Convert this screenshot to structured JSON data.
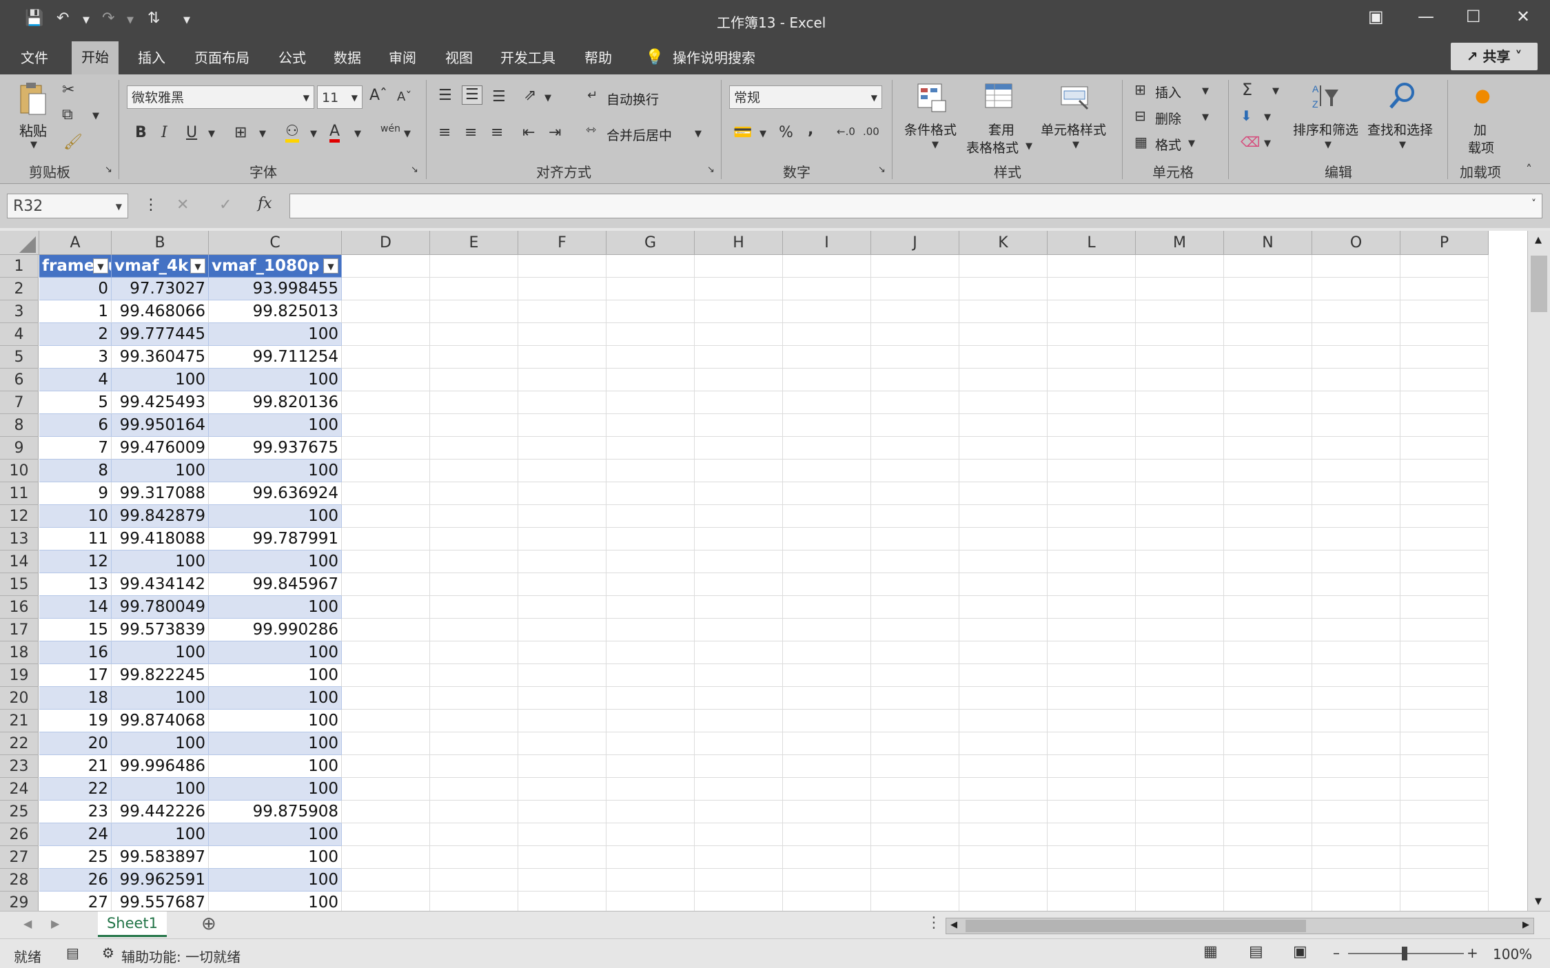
{
  "titlebar": {
    "title": "工作簿13  -  Excel",
    "quick_access": {
      "save_icon": "save-icon",
      "undo_icon": "undo-icon",
      "redo_icon": "redo-icon",
      "sort_icon": "sort-icon",
      "customize_icon": "customize-icon"
    },
    "window_controls": [
      "ribbon-display-icon",
      "minimize-icon",
      "maximize-icon",
      "close-icon"
    ]
  },
  "menu": {
    "tabs": [
      "文件",
      "开始",
      "插入",
      "页面布局",
      "公式",
      "数据",
      "审阅",
      "视图",
      "开发工具",
      "帮助"
    ],
    "active_tab": "开始",
    "tell_me": "操作说明搜索",
    "share": "共享"
  },
  "ribbon": {
    "clipboard": {
      "label": "剪贴板",
      "paste": "粘贴"
    },
    "font": {
      "label": "字体",
      "font_name": "微软雅黑",
      "font_size": "11",
      "bold": "B",
      "italic": "I",
      "underline": "U",
      "wen": "wén"
    },
    "alignment": {
      "label": "对齐方式",
      "wrap_text": "自动换行",
      "merge_center": "合并后居中"
    },
    "number": {
      "label": "数字",
      "format": "常规",
      "percent": "%",
      "comma": ","
    },
    "styles": {
      "label": "样式",
      "conditional": "条件格式",
      "table_format_1": "套用",
      "table_format_2": "表格格式",
      "cell_styles": "单元格样式"
    },
    "cells": {
      "label": "单元格",
      "insert": "插入",
      "delete": "删除",
      "format": "格式"
    },
    "editing": {
      "label": "编辑",
      "sum": "Σ",
      "sort_filter": "排序和筛选",
      "find_select": "查找和选择"
    },
    "addins": {
      "label": "加载项",
      "addins_1": "加",
      "addins_2": "载项"
    }
  },
  "formula_bar": {
    "name_box": "R32",
    "fx": "fx",
    "formula": ""
  },
  "sheet": {
    "columns": [
      "A",
      "B",
      "C",
      "D",
      "E",
      "F",
      "G",
      "H",
      "I",
      "J",
      "K",
      "L",
      "M",
      "N",
      "O",
      "P"
    ],
    "row_numbers": [
      "1",
      "2",
      "3",
      "4",
      "5",
      "6",
      "7",
      "8",
      "9",
      "10",
      "11",
      "12",
      "13",
      "14",
      "15",
      "16",
      "17",
      "18",
      "19",
      "20",
      "21",
      "22",
      "23",
      "24",
      "25",
      "26",
      "27",
      "28",
      "29"
    ],
    "table_headers": [
      "frameNum",
      "vmaf_4k",
      "vmaf_1080p"
    ],
    "rows": [
      [
        "0",
        "97.73027",
        "93.998455"
      ],
      [
        "1",
        "99.468066",
        "99.825013"
      ],
      [
        "2",
        "99.777445",
        "100"
      ],
      [
        "3",
        "99.360475",
        "99.711254"
      ],
      [
        "4",
        "100",
        "100"
      ],
      [
        "5",
        "99.425493",
        "99.820136"
      ],
      [
        "6",
        "99.950164",
        "100"
      ],
      [
        "7",
        "99.476009",
        "99.937675"
      ],
      [
        "8",
        "100",
        "100"
      ],
      [
        "9",
        "99.317088",
        "99.636924"
      ],
      [
        "10",
        "99.842879",
        "100"
      ],
      [
        "11",
        "99.418088",
        "99.787991"
      ],
      [
        "12",
        "100",
        "100"
      ],
      [
        "13",
        "99.434142",
        "99.845967"
      ],
      [
        "14",
        "99.780049",
        "100"
      ],
      [
        "15",
        "99.573839",
        "99.990286"
      ],
      [
        "16",
        "100",
        "100"
      ],
      [
        "17",
        "99.822245",
        "100"
      ],
      [
        "18",
        "100",
        "100"
      ],
      [
        "19",
        "99.874068",
        "100"
      ],
      [
        "20",
        "100",
        "100"
      ],
      [
        "21",
        "99.996486",
        "100"
      ],
      [
        "22",
        "100",
        "100"
      ],
      [
        "23",
        "99.442226",
        "99.875908"
      ],
      [
        "24",
        "100",
        "100"
      ],
      [
        "25",
        "99.583897",
        "100"
      ],
      [
        "26",
        "99.962591",
        "100"
      ],
      [
        "27",
        "99.557687",
        "100"
      ]
    ],
    "tab_name": "Sheet1"
  },
  "status": {
    "ready": "就绪",
    "accessibility": "辅助功能: 一切就绪",
    "zoom": "100%"
  },
  "colors": {
    "titlebar": "#454545",
    "ribbon": "#c6c6c6",
    "table_header": "#4472c4",
    "band": "#d9e1f2",
    "excel_green": "#217346"
  }
}
